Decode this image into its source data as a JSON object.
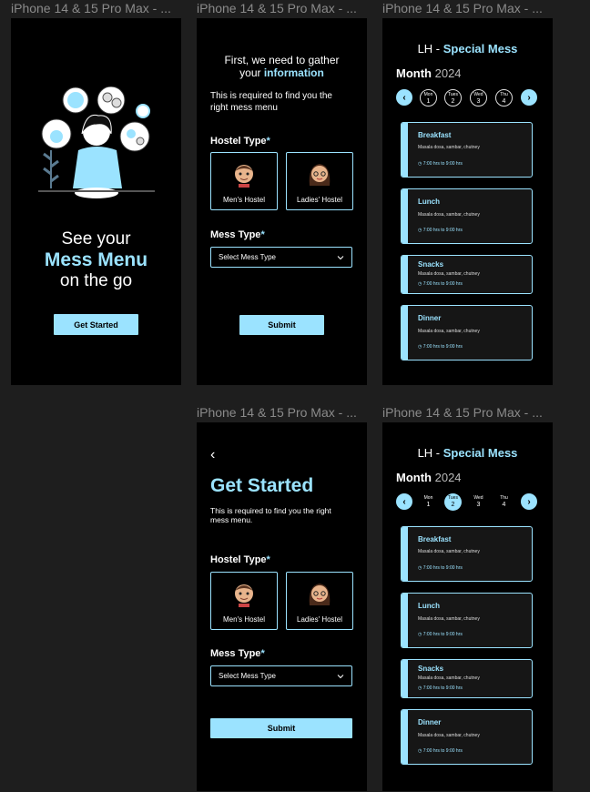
{
  "frames": {
    "label": "iPhone 14 & 15 Pro Max - ..."
  },
  "onboarding": {
    "line1": "See your",
    "line2": "Mess Menu",
    "line3": "on the go",
    "button": "Get Started"
  },
  "info_screen": {
    "heading_line1": "First, we need to gather",
    "heading_line2_prefix": "your ",
    "heading_line2_accent": "information",
    "subtext": "This is required to find you the right mess menu",
    "hostel_type_label": "Hostel Type",
    "required_mark": "*",
    "mens_hostel": "Men's Hostel",
    "ladies_hostel": "Ladies' Hostel",
    "mess_type_label": "Mess Type",
    "select_placeholder": "Select Mess Type",
    "submit": "Submit"
  },
  "get_started_screen": {
    "back": "‹",
    "title": "Get Started",
    "subtext": "This is required to find you the right mess menu.",
    "hostel_type_label": "Hostel Type",
    "required_mark": "*",
    "mens_hostel": "Men's Hostel",
    "ladies_hostel": "Ladies' Hostel",
    "mess_type_label": "Mess Type",
    "select_placeholder": "Select Mess Type",
    "submit": "Submit"
  },
  "menu_screen": {
    "title_prefix": "LH - ",
    "title_accent": "Special Mess",
    "month_label": "Month",
    "year": "2024",
    "prev": "‹",
    "next": "›",
    "days": [
      {
        "name": "Mon",
        "num": "1"
      },
      {
        "name": "Tues",
        "num": "2"
      },
      {
        "name": "Wed",
        "num": "3"
      },
      {
        "name": "Thu",
        "num": "4"
      }
    ],
    "meals": [
      {
        "name": "Breakfast",
        "desc": "Masala dosa, sambar, chutney",
        "time": "7:00 hrs to 9:00 hrs"
      },
      {
        "name": "Lunch",
        "desc": "Masala dosa, sambar, chutney",
        "time": "7:00 hrs to 9:00 hrs"
      },
      {
        "name": "Snacks",
        "desc": "Masala dosa, sambar, chutney",
        "time": "7:00 hrs to 9:00 hrs"
      },
      {
        "name": "Dinner",
        "desc": "Masala dosa, sambar, chutney",
        "time": "7:00 hrs to 9:00 hrs"
      }
    ]
  },
  "colors": {
    "accent": "#9be3ff",
    "canvas": "#1e1e1e",
    "screen": "#000000"
  },
  "icons": [
    "chevron-left-icon",
    "chevron-right-icon",
    "chevron-down-icon",
    "clock-icon",
    "memoji-man-icon",
    "memoji-woman-icon",
    "illustration"
  ]
}
